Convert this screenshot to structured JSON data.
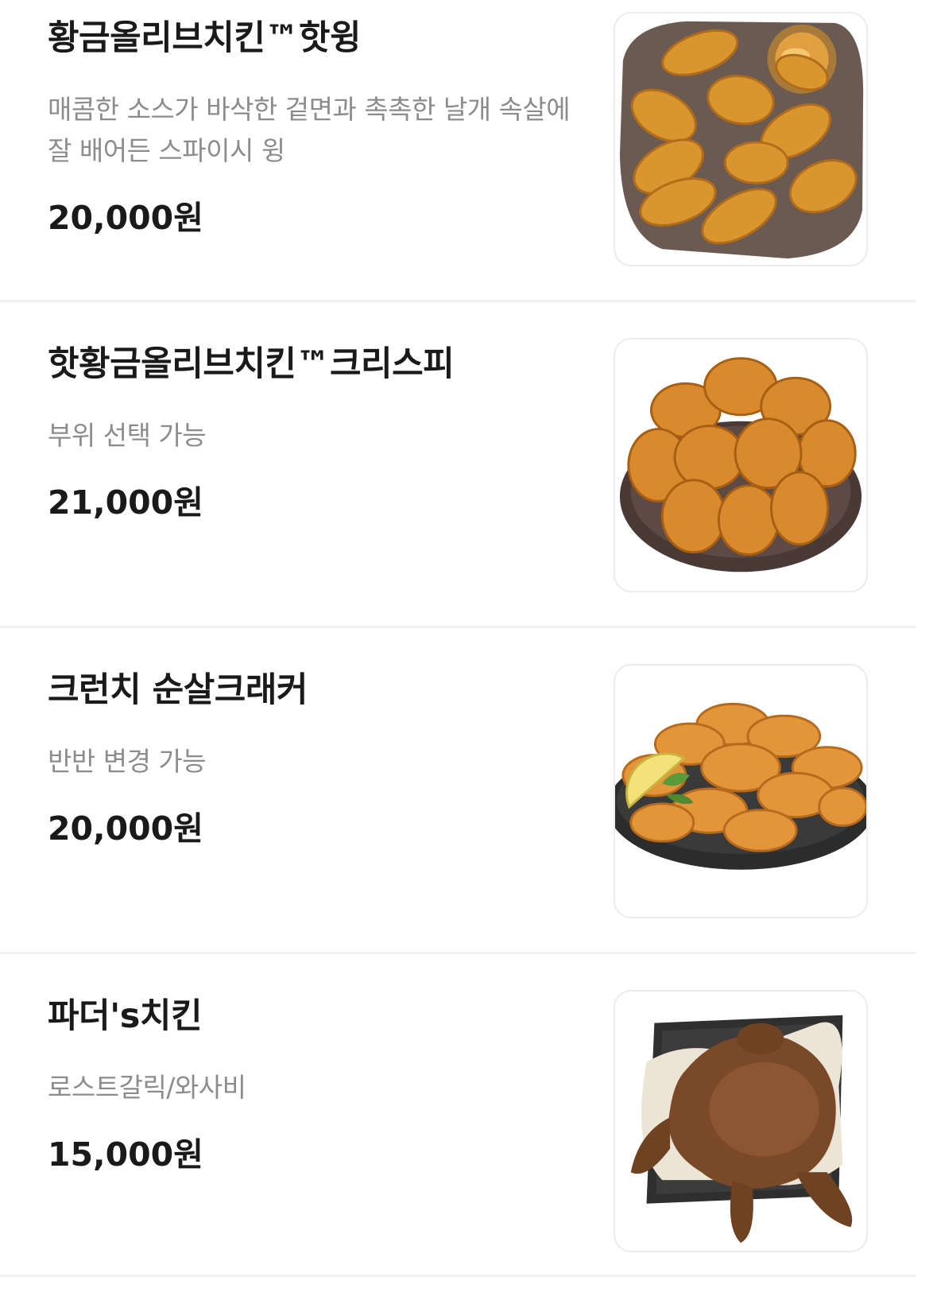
{
  "menu": {
    "items": [
      {
        "name": "황금올리브치킨™핫윙",
        "description": "매콤한 소스가 바삭한 겉면과 촉촉한 날개 속살에 잘 배어든 스파이시 윙",
        "price": "20,000원",
        "image_icon": "chicken-wings-with-dipping-sauce"
      },
      {
        "name": "핫황금올리브치킨™크리스피",
        "description": "부위 선택 가능",
        "price": "21,000원",
        "image_icon": "crispy-fried-chicken-pile"
      },
      {
        "name": "크런치 순살크래커",
        "description": "반반 변경 가능",
        "price": "20,000원",
        "image_icon": "boneless-crispy-chicken-with-lemon"
      },
      {
        "name": "파더's치킨",
        "description": "로스트갈릭/와사비",
        "price": "15,000원",
        "image_icon": "whole-roast-chicken-on-tray"
      }
    ]
  }
}
